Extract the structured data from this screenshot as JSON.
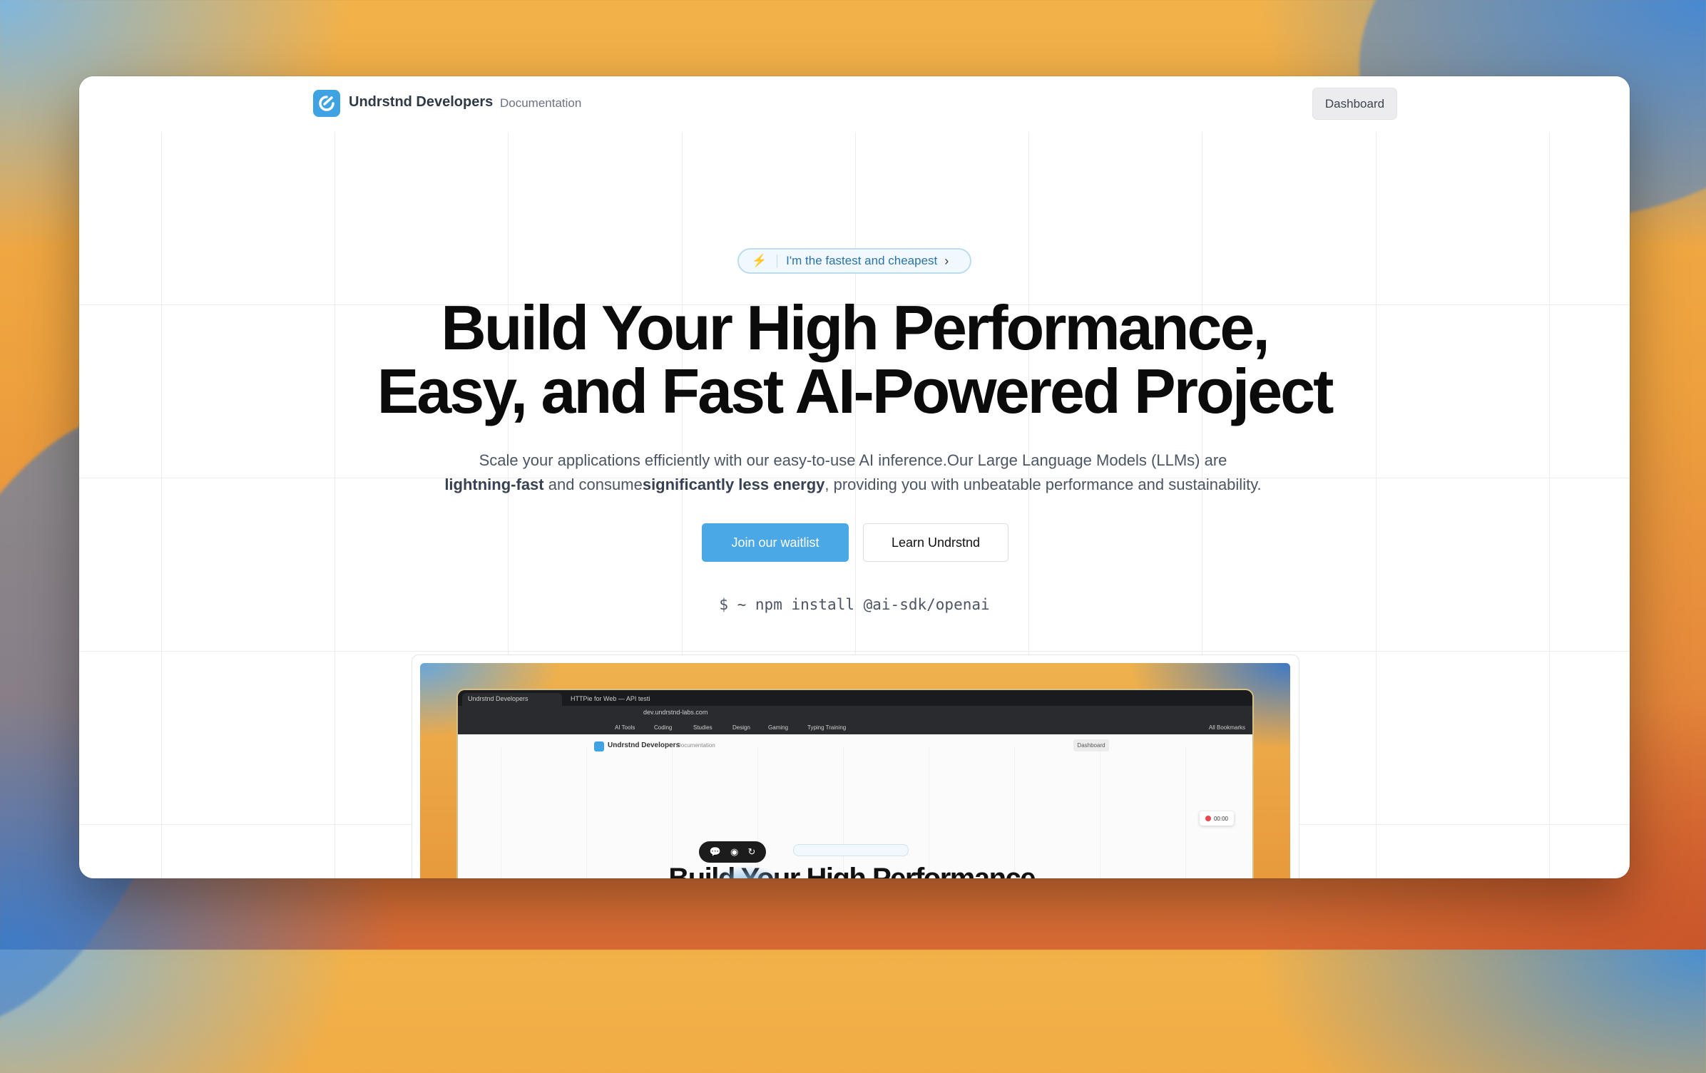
{
  "navbar": {
    "brand": "Undrstnd Developers",
    "docs_link": "Documentation",
    "dashboard_button": "Dashboard"
  },
  "hero": {
    "pill_text": "I'm the fastest and cheapest",
    "title_line1": "Build Your High Performance,",
    "title_line2": "Easy, and Fast AI-Powered Project",
    "subtitle_part1": "Scale your applications efficiently with our easy-to-use AI inference.Our Large Language Models (LLMs) are ",
    "subtitle_bold1": "lightning-fast",
    "subtitle_part2": " and consume",
    "subtitle_bold2": "significantly less energy",
    "subtitle_part3": ", providing you with unbeatable performance and sustainability.",
    "primary_button": "Join our waitlist",
    "secondary_button": "Learn Undrstnd",
    "install_command": "$ ~ npm install @ai-sdk/openai"
  },
  "preview": {
    "tab1": "Undrstnd Developers",
    "tab2": "HTTPie for Web — API testi",
    "url": "dev.undrstnd-labs.com",
    "bookmarks": [
      "AI Tools",
      "Coding",
      "Studies",
      "Design",
      "Gaming",
      "Typing Training"
    ],
    "all_bookmarks": "All Bookmarks",
    "brand": "Undrstnd Developers",
    "docs": "Documentation",
    "dashboard": "Dashboard",
    "timer": "00:00",
    "title": "Build Your High Performance,"
  },
  "colors": {
    "accent": "#4aa8e6",
    "logo": "#3ea2e3",
    "pill_text": "#2a73a8"
  }
}
